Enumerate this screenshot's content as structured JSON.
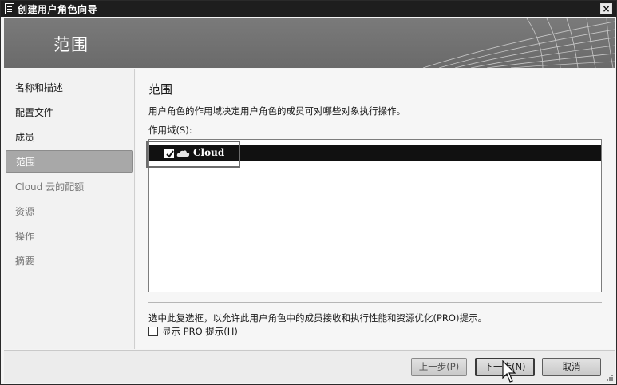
{
  "window": {
    "title": "创建用户角色向导",
    "close_glyph": "×"
  },
  "header": {
    "title": "范围"
  },
  "sidebar": {
    "items": [
      {
        "label": "名称和描述"
      },
      {
        "label": "配置文件"
      },
      {
        "label": "成员"
      },
      {
        "label": "范围"
      },
      {
        "label": "Cloud 云的配额"
      },
      {
        "label": "资源"
      },
      {
        "label": "操作"
      },
      {
        "label": "摘要"
      }
    ],
    "active_index": 3
  },
  "main": {
    "section_title": "范围",
    "description": "用户角色的作用域决定用户角色的成员可对哪些对象执行操作。",
    "scope_label": "作用域(S):",
    "scope_items": [
      {
        "label": "Cloud",
        "checked": true,
        "icon": "cloud-icon"
      }
    ],
    "info_text": "选中此复选框，以允许此用户角色中的成员接收和执行性能和资源优化(PRO)提示。",
    "pro_checkbox_label": "显示 PRO 提示(H)",
    "pro_checked": false
  },
  "footer": {
    "back_label": "上一步(P)",
    "next_label": "下一步(N)",
    "cancel_label": "取消"
  }
}
